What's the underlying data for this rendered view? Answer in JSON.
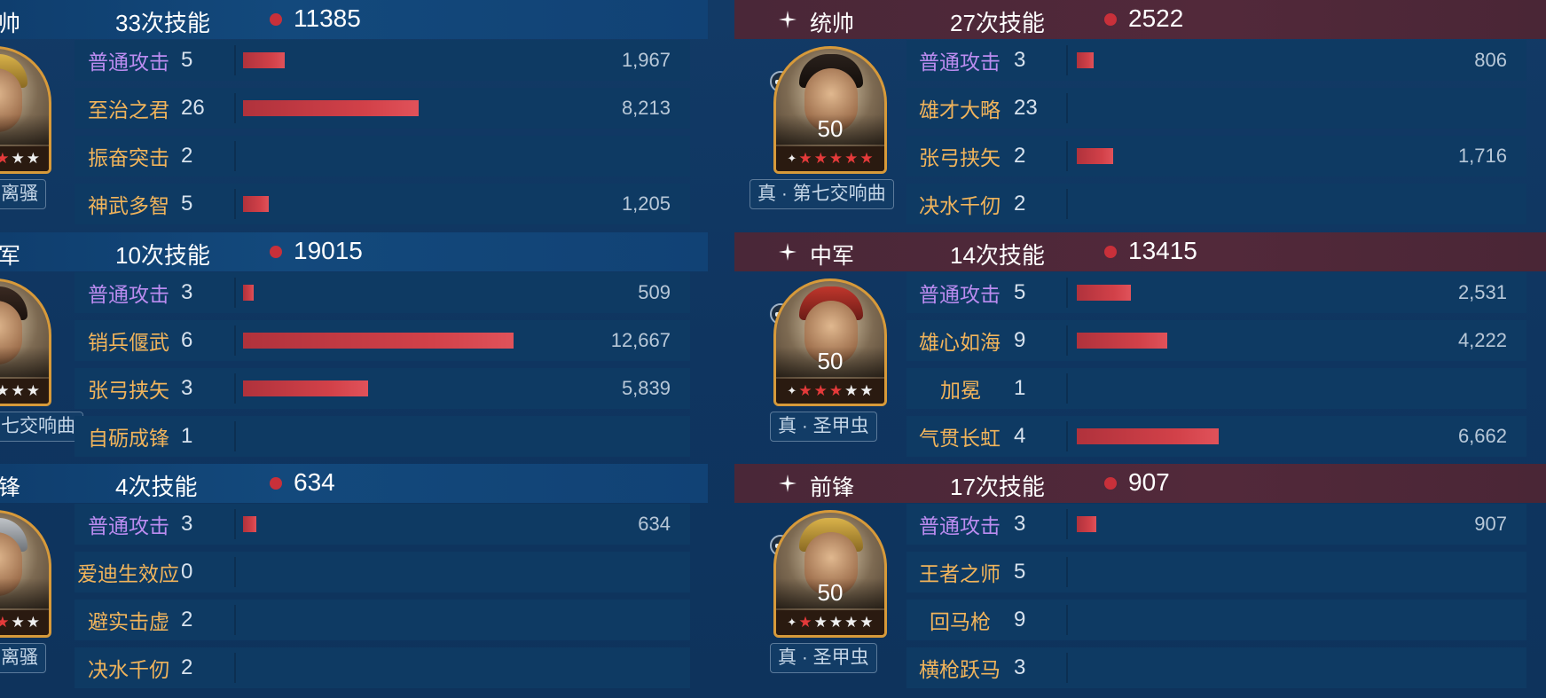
{
  "colors": {
    "normal_attack": "#bb8cf0",
    "skill": "#f1b45b",
    "bar": "#d24149",
    "left_header": "#13497c",
    "right_header": "#52293a"
  },
  "left": {
    "panels": [
      {
        "role": "帅",
        "casts": "33次技能",
        "total": "11385",
        "tactic": "离骚",
        "level": "0",
        "rows": [
          {
            "name": "普通攻击",
            "count": "5",
            "value": "1,967",
            "amount": 1967,
            "normal": true
          },
          {
            "name": "至治之君",
            "count": "26",
            "value": "8,213",
            "amount": 8213
          },
          {
            "name": "振奋突击",
            "count": "2",
            "value": "",
            "amount": 0
          },
          {
            "name": "神武多智",
            "count": "5",
            "value": "1,205",
            "amount": 1205
          }
        ]
      },
      {
        "role": "军",
        "casts": "10次技能",
        "total": "19015",
        "tactic": "七交响曲",
        "level": "0",
        "rows": [
          {
            "name": "普通攻击",
            "count": "3",
            "value": "509",
            "amount": 509,
            "normal": true
          },
          {
            "name": "销兵偃武",
            "count": "6",
            "value": "12,667",
            "amount": 12667
          },
          {
            "name": "张弓挟矢",
            "count": "3",
            "value": "5,839",
            "amount": 5839
          },
          {
            "name": "自砺成锋",
            "count": "1",
            "value": "",
            "amount": 0
          }
        ]
      },
      {
        "role": "锋",
        "casts": "4次技能",
        "total": "634",
        "tactic": "离骚",
        "level": "0",
        "rows": [
          {
            "name": "普通攻击",
            "count": "3",
            "value": "634",
            "amount": 634,
            "normal": true
          },
          {
            "name": "爱迪生效应",
            "count": "0",
            "value": "",
            "amount": 0
          },
          {
            "name": "避实击虚",
            "count": "2",
            "value": "",
            "amount": 0
          },
          {
            "name": "决水千仞",
            "count": "2",
            "value": "",
            "amount": 0
          }
        ]
      }
    ]
  },
  "right": {
    "panels": [
      {
        "role": "统帅",
        "casts": "27次技能",
        "total": "2522",
        "tactic": "真 · 第七交响曲",
        "level": "50",
        "red_stars": 5,
        "rows": [
          {
            "name": "普通攻击",
            "count": "3",
            "value": "806",
            "amount": 806,
            "normal": true
          },
          {
            "name": "雄才大略",
            "count": "23",
            "value": "",
            "amount": 0
          },
          {
            "name": "张弓挟矢",
            "count": "2",
            "value": "1,716",
            "amount": 1716
          },
          {
            "name": "决水千仞",
            "count": "2",
            "value": "",
            "amount": 0
          }
        ]
      },
      {
        "role": "中军",
        "casts": "14次技能",
        "total": "13415",
        "tactic": "真 · 圣甲虫",
        "level": "50",
        "red_stars": 3,
        "rows": [
          {
            "name": "普通攻击",
            "count": "5",
            "value": "2,531",
            "amount": 2531,
            "normal": true
          },
          {
            "name": "雄心如海",
            "count": "9",
            "value": "4,222",
            "amount": 4222
          },
          {
            "name": "加冕",
            "count": "1",
            "value": "",
            "amount": 0,
            "centered": true
          },
          {
            "name": "气贯长虹",
            "count": "4",
            "value": "6,662",
            "amount": 6662
          }
        ]
      },
      {
        "role": "前锋",
        "casts": "17次技能",
        "total": "907",
        "tactic": "真 · 圣甲虫",
        "level": "50",
        "red_stars": 1,
        "rows": [
          {
            "name": "普通攻击",
            "count": "3",
            "value": "907",
            "amount": 907,
            "normal": true
          },
          {
            "name": "王者之师",
            "count": "5",
            "value": "",
            "amount": 0
          },
          {
            "name": "回马枪",
            "count": "9",
            "value": "",
            "amount": 0,
            "centered": true
          },
          {
            "name": "横枪跃马",
            "count": "3",
            "value": "",
            "amount": 0
          }
        ]
      }
    ]
  }
}
